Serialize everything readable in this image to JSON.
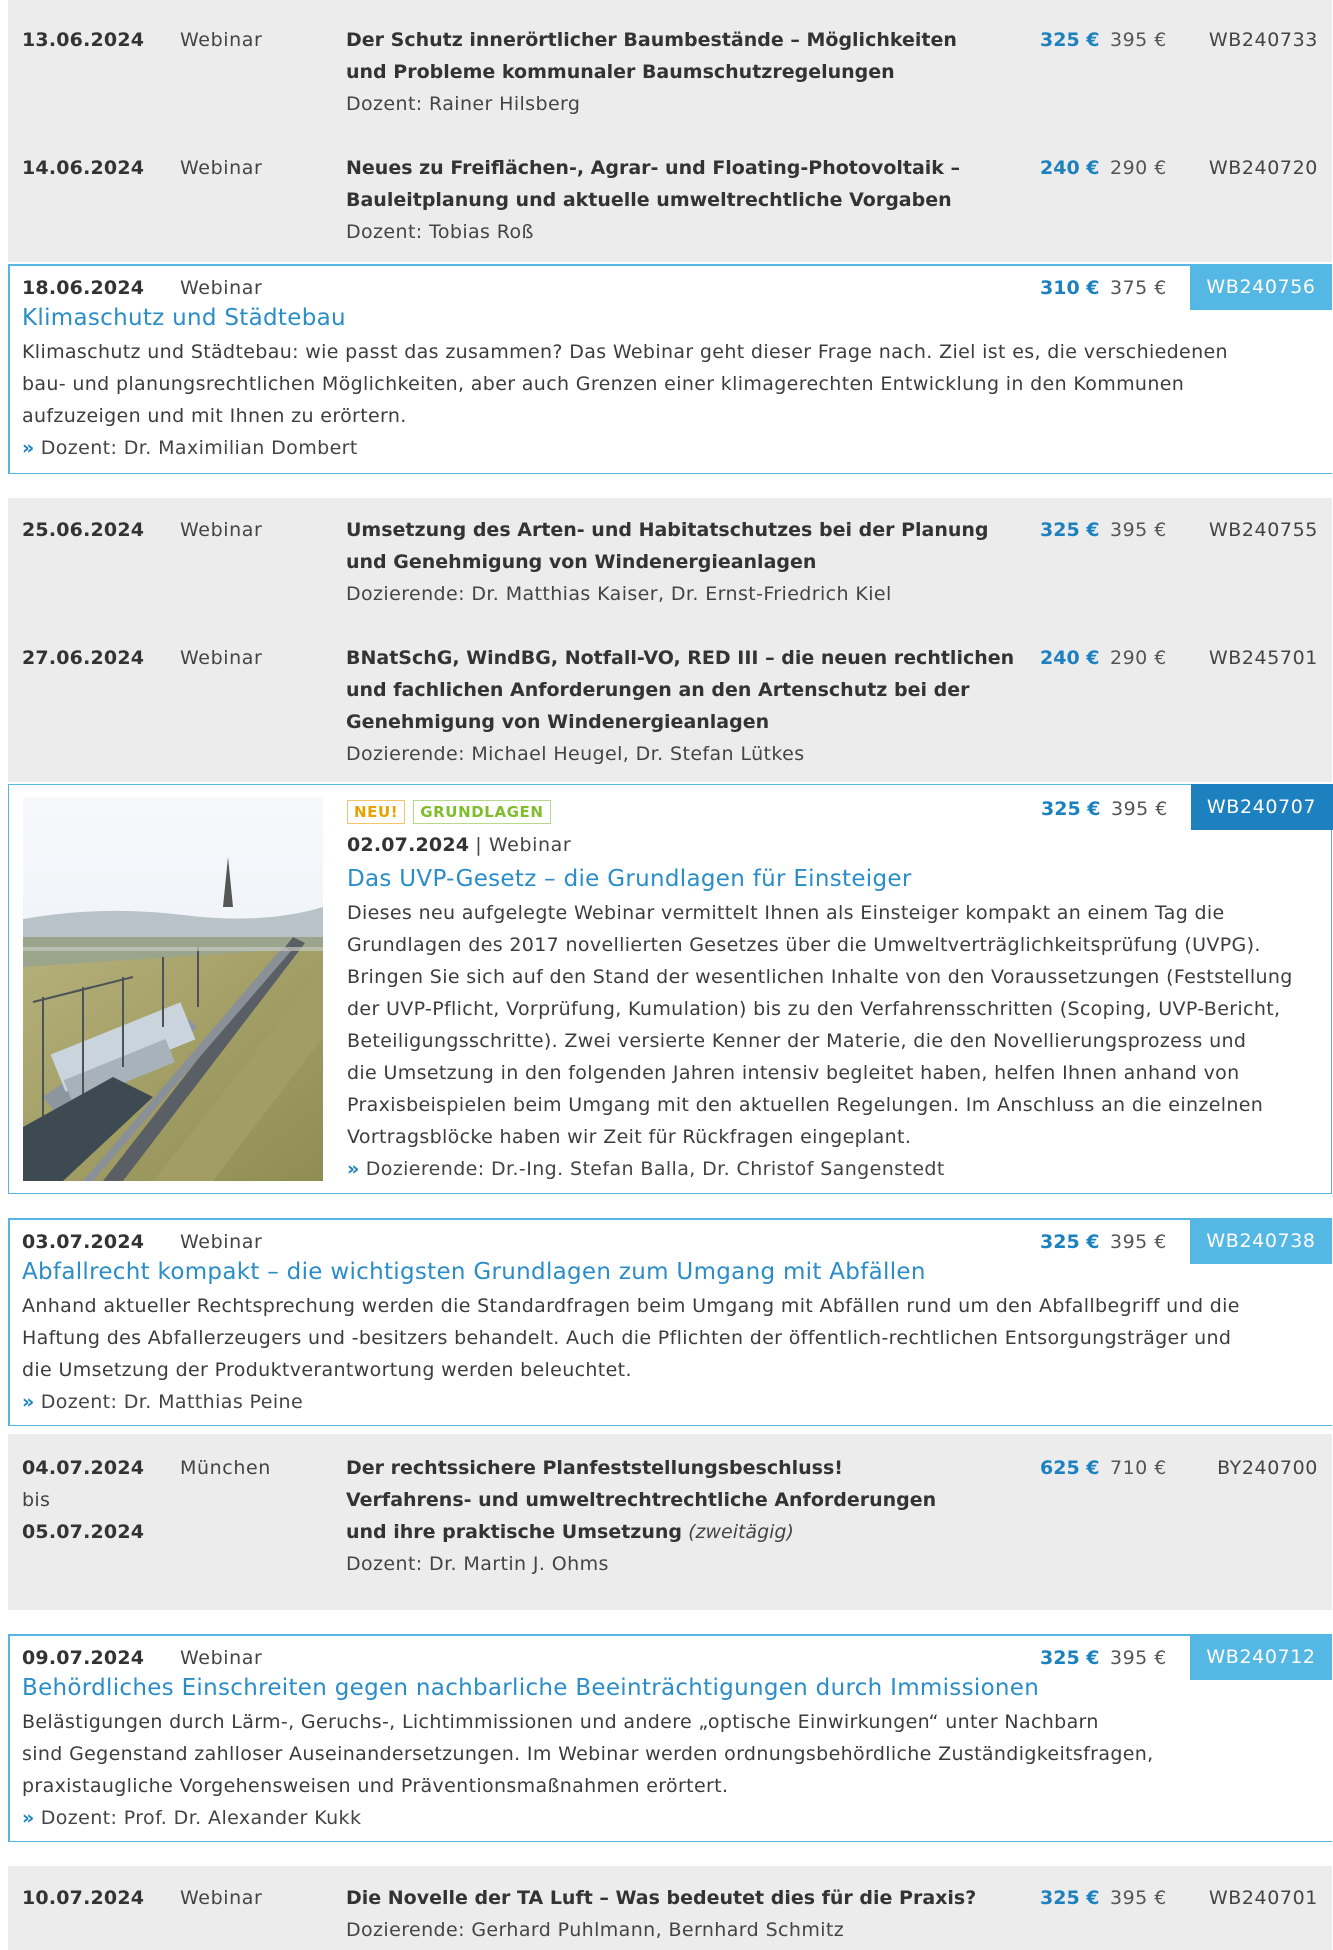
{
  "events": [
    {
      "date": "13.06.2024",
      "type": "Webinar",
      "title_lines": [
        "Der Schutz innerörtlicher Baumbestände – Möglichkeiten",
        "und Probleme kommunaler Baumschutzregelungen"
      ],
      "teacher": "Dozent: Rainer Hilsberg",
      "price": "325 €",
      "price_regular": "395 €",
      "code": "WB240733"
    },
    {
      "date": "14.06.2024",
      "type": "Webinar",
      "title_lines": [
        "Neues zu Freiflächen-, Agrar- und Floating-Photovoltaik –",
        "Bauleitplanung und aktuelle umweltrechtliche Vorgaben"
      ],
      "teacher": "Dozent: Tobias Roß",
      "price": "240 €",
      "price_regular": "290 €",
      "code": "WB240720"
    },
    {
      "date": "18.06.2024",
      "type": "Webinar",
      "title": "Klimaschutz und Städtebau",
      "desc_lines": [
        "Klimaschutz und Städtebau: wie passt das zusammen? Das Webinar geht dieser Frage nach. Ziel ist es, die verschiedenen",
        "bau- und planungsrechtlichen Möglichkeiten, aber auch Grenzen einer klimagerechten Entwicklung in den Kommunen",
        "aufzuzeigen und mit Ihnen zu erörtern."
      ],
      "teacher": "Dozent: Dr. Maximilian Dombert",
      "price": "310 €",
      "price_regular": "375 €",
      "code": "WB240756"
    },
    {
      "date": "25.06.2024",
      "type": "Webinar",
      "title_lines": [
        "Umsetzung des Arten- und Habitatschutzes bei der Planung",
        "und Genehmigung von Windenergieanlagen"
      ],
      "teacher": "Dozierende: Dr. Matthias Kaiser, Dr. Ernst-Friedrich Kiel",
      "price": "325 €",
      "price_regular": "395 €",
      "code": "WB240755"
    },
    {
      "date": "27.06.2024",
      "type": "Webinar",
      "title_lines": [
        "BNatSchG, WindBG, Notfall-VO, RED III – die neuen rechtlichen",
        "und fachlichen Anforderungen an den Artenschutz bei der",
        "Genehmigung von Windenergieanlagen"
      ],
      "teacher": "Dozierende: Michael Heugel, Dr. Stefan Lütkes",
      "price": "240 €",
      "price_regular": "290 €",
      "code": "WB245701"
    },
    {
      "badges": [
        "NEU!",
        "GRUNDLAGEN"
      ],
      "date": "02.07.2024",
      "type": "| Webinar",
      "title": "Das UVP-Gesetz – die Grundlagen für Einsteiger",
      "desc_lines": [
        "Dieses neu aufgelegte Webinar vermittelt Ihnen als Einsteiger kompakt an einem Tag die",
        "Grundlagen des 2017 novellierten Gesetzes über die Umweltverträglichkeitsprüfung (UVPG).",
        "Bringen Sie sich auf den Stand der wesentlichen Inhalte von den Voraussetzungen (Feststellung",
        "der UVP-Pflicht, Vorprüfung, Kumulation) bis zu den Verfahrensschritten (Scoping, UVP-Bericht,",
        "Beteiligungsschritte). Zwei versierte Kenner der Materie, die den Novellierungsprozess und",
        "die Umsetzung in den folgenden Jahren intensiv begleitet haben, helfen Ihnen anhand von",
        "Praxisbeispielen beim Umgang mit den aktuellen Regelungen. Im Anschluss an die einzelnen",
        "Vortragsblöcke haben wir Zeit für Rückfragen eingeplant."
      ],
      "teacher": "Dozierende: Dr.-Ing. Stefan Balla, Dr. Christof Sangenstedt",
      "price": "325 €",
      "price_regular": "395 €",
      "code": "WB240707"
    },
    {
      "date": "03.07.2024",
      "type": "Webinar",
      "title": "Abfallrecht kompakt – die wichtigsten Grundlagen zum Umgang mit Abfällen",
      "desc_lines": [
        "Anhand aktueller Rechtsprechung werden die Standardfragen beim Umgang mit Abfällen rund um den Abfallbegriff und die",
        "Haftung des Abfallerzeugers und -besitzers behandelt. Auch die Pflichten der öffentlich-rechtlichen Entsorgungsträger und",
        "die Umsetzung der Produktverantwortung werden beleuchtet."
      ],
      "teacher": "Dozent: Dr. Matthias Peine",
      "price": "325 €",
      "price_regular": "395 €",
      "code": "WB240738"
    },
    {
      "date": "04.07.2024",
      "date_mid": "bis",
      "date_end": "05.07.2024",
      "type": "München",
      "title_lines": [
        "Der rechtssichere Planfeststellungsbeschluss!",
        "Verfahrens- und umweltrechtrechtliche Anforderungen",
        "und ihre praktische Umsetzung"
      ],
      "title_suffix": "(zweitägig)",
      "teacher": "Dozent: Dr. Martin J. Ohms",
      "price": "625 €",
      "price_regular": "710 €",
      "code": "BY240700"
    },
    {
      "date": "09.07.2024",
      "type": "Webinar",
      "title": "Behördliches Einschreiten gegen nachbarliche Beeinträchtigungen durch Immissionen",
      "desc_lines": [
        "Belästigungen durch Lärm-, Geruchs-, Lichtimmissionen und andere „optische Einwirkungen“ unter Nachbarn",
        "sind Gegenstand zahlloser Auseinandersetzungen. Im Webinar werden ordnungsbehördliche Zuständigkeitsfragen,",
        "praxistaugliche Vorgehensweisen und Präventionsmaßnahmen erörtert."
      ],
      "teacher": "Dozent: Prof. Dr. Alexander Kukk",
      "price": "325 €",
      "price_regular": "395 €",
      "code": "WB240712"
    },
    {
      "date": "10.07.2024",
      "type": "Webinar",
      "title_lines": [
        "Die Novelle der TA Luft – Was bedeutet dies für die Praxis?"
      ],
      "teacher": "Dozierende: Gerhard Puhlmann, Bernhard Schmitz",
      "price": "325 €",
      "price_regular": "395 €",
      "code": "WB240701"
    }
  ],
  "bullet_icon": "double-chevron-right-icon",
  "colors": {
    "accent": "#1d81bf",
    "light_accent": "#55b8e4",
    "row_bg": "#ececec",
    "badge_new": "#e8a200",
    "badge_grundlagen": "#7fbd2c"
  }
}
